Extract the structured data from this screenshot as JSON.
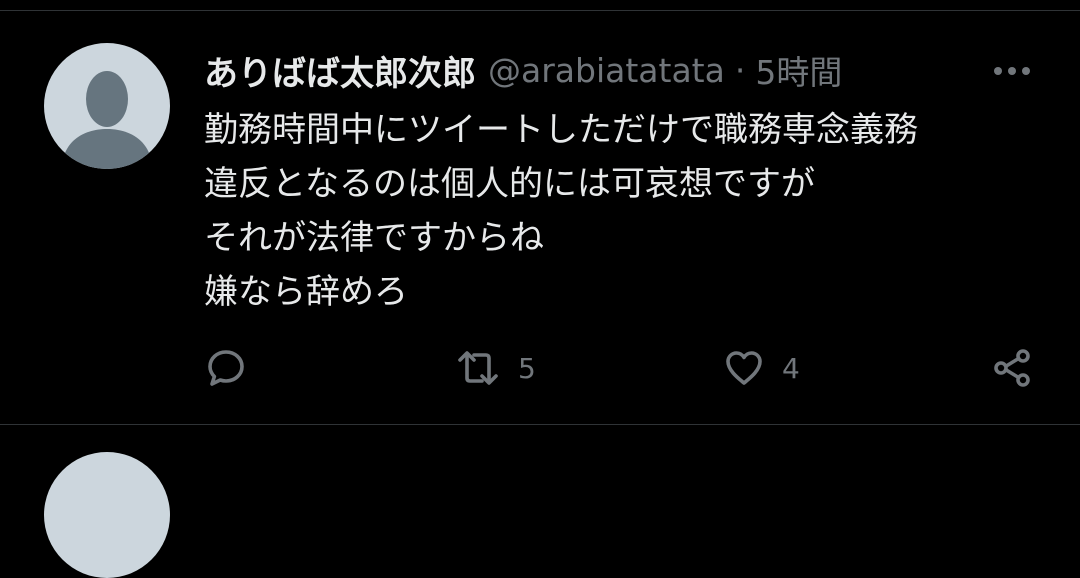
{
  "tweet": {
    "display_name": "ありばば太郎次郎",
    "handle": "@arabiatatata",
    "separator": "·",
    "time": "5時間",
    "text_lines": [
      "勤務時間中にツイートしただけで職務専念義務",
      "違反となるのは個人的には可哀想ですが",
      "それが法律ですからね",
      "嫌なら辞めろ"
    ],
    "actions": {
      "reply_icon": "reply-icon",
      "retweet_icon": "retweet-icon",
      "retweet_count": "5",
      "like_icon": "heart-icon",
      "like_count": "4",
      "share_icon": "share-icon",
      "more_icon": "more-options-icon"
    }
  },
  "colors": {
    "background": "#000000",
    "text": "#e7e9ea",
    "secondary_text": "#71767b",
    "divider": "#2f3336",
    "avatar_bg": "#ccd6dd",
    "avatar_figure": "#66757f"
  }
}
